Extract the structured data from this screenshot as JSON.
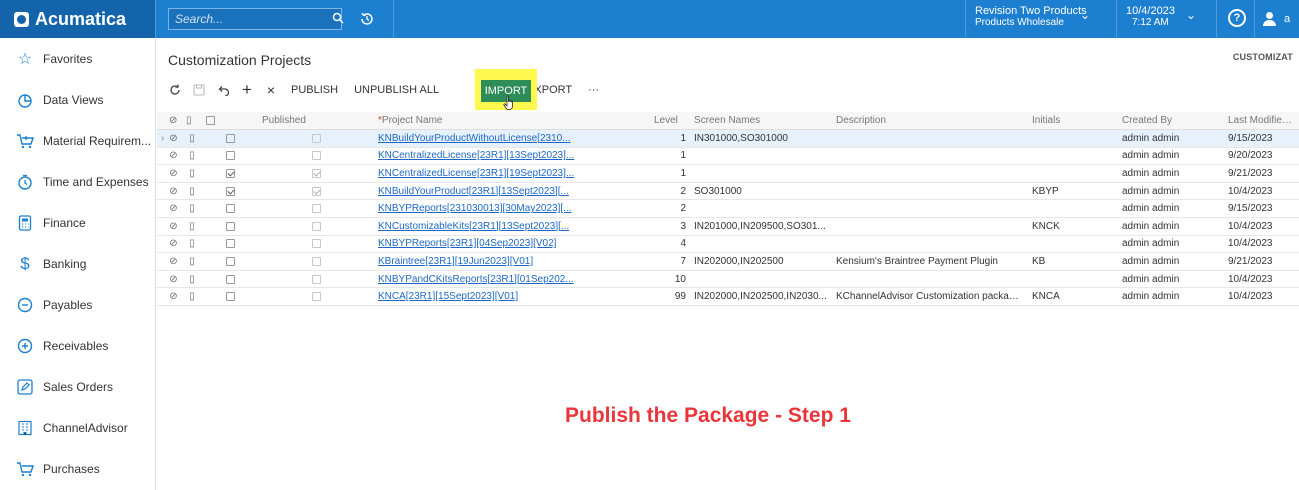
{
  "app": {
    "logo": "Acumatica",
    "search_placeholder": "Search...",
    "tenant_line1": "Revision Two Products",
    "tenant_line2": "Products Wholesale",
    "date": "10/4/2023",
    "time": "7:12 AM",
    "user_initials": "a"
  },
  "sidebar": {
    "items": [
      {
        "label": "Favorites",
        "icon": "star-icon"
      },
      {
        "label": "Data Views",
        "icon": "pie-chart-icon"
      },
      {
        "label": "Material Requirem...",
        "icon": "cart-icon"
      },
      {
        "label": "Time and Expenses",
        "icon": "clock-icon"
      },
      {
        "label": "Finance",
        "icon": "calculator-icon"
      },
      {
        "label": "Banking",
        "icon": "dollar-icon"
      },
      {
        "label": "Payables",
        "icon": "minus-circle-icon"
      },
      {
        "label": "Receivables",
        "icon": "plus-circle-icon"
      },
      {
        "label": "Sales Orders",
        "icon": "pencil-icon"
      },
      {
        "label": "ChannelAdvisor",
        "icon": "building-icon"
      },
      {
        "label": "Purchases",
        "icon": "cart-icon"
      }
    ]
  },
  "page": {
    "title": "Customization Projects",
    "tag": "CUSTOMIZAT"
  },
  "toolbar": {
    "publish": "PUBLISH",
    "unpublish_all": "UNPUBLISH ALL",
    "import": "IMPORT",
    "export": "EXPORT",
    "more": "···"
  },
  "grid": {
    "headers": {
      "published": "Published",
      "required_mark": "*",
      "project_name": "Project Name",
      "level": "Level",
      "screen_names": "Screen Names",
      "description": "Description",
      "initials": "Initials",
      "created_by": "Created By",
      "last_modified": "Last Modified On"
    },
    "rows": [
      {
        "checked": false,
        "published": false,
        "name": "KNBuildYourProductWithoutLicense[2310...",
        "level": "1",
        "screens": "IN301000,SO301000",
        "description": "",
        "initials": "",
        "created_by": "admin admin",
        "modified": "9/15/2023",
        "selected": true
      },
      {
        "checked": false,
        "published": false,
        "name": "KNCentralizedLicense[23R1][13Sept2023]...",
        "level": "1",
        "screens": "",
        "description": "",
        "initials": "",
        "created_by": "admin admin",
        "modified": "9/20/2023",
        "selected": false
      },
      {
        "checked": true,
        "published": true,
        "name": "KNCentralizedLicense[23R1][19Sept2023]...",
        "level": "1",
        "screens": "",
        "description": "",
        "initials": "",
        "created_by": "admin admin",
        "modified": "9/21/2023",
        "selected": false
      },
      {
        "checked": true,
        "published": true,
        "name": "KNBuildYourProduct[23R1][13Sept2023][...",
        "level": "2",
        "screens": "SO301000",
        "description": "",
        "initials": "KBYP",
        "created_by": "admin admin",
        "modified": "10/4/2023",
        "selected": false
      },
      {
        "checked": false,
        "published": false,
        "name": "KNBYPReports[231030013][30May2023][...",
        "level": "2",
        "screens": "",
        "description": "",
        "initials": "",
        "created_by": "admin admin",
        "modified": "9/15/2023",
        "selected": false
      },
      {
        "checked": false,
        "published": false,
        "name": "KNCustomizableKits[23R1][13Sept2023][...",
        "level": "3",
        "screens": "IN201000,IN209500,SO301...",
        "description": "",
        "initials": "KNCK",
        "created_by": "admin admin",
        "modified": "10/4/2023",
        "selected": false
      },
      {
        "checked": false,
        "published": false,
        "name": "KNBYPReports[23R1][04Sep2023][V02]",
        "level": "4",
        "screens": "",
        "description": "",
        "initials": "",
        "created_by": "admin admin",
        "modified": "10/4/2023",
        "selected": false
      },
      {
        "checked": false,
        "published": false,
        "name": "KBraintree[23R1][19Jun2023][V01]",
        "level": "7",
        "screens": "IN202000,IN202500",
        "description": "Kensium's Braintree Payment Plugin",
        "initials": "KB",
        "created_by": "admin admin",
        "modified": "9/21/2023",
        "selected": false
      },
      {
        "checked": false,
        "published": false,
        "name": "KNBYPandCKitsReports[23R1][01Sep202...",
        "level": "10",
        "screens": "",
        "description": "",
        "initials": "",
        "created_by": "admin admin",
        "modified": "10/4/2023",
        "selected": false
      },
      {
        "checked": false,
        "published": false,
        "name": "KNCA[23R1][15Sept2023][V01]",
        "level": "99",
        "screens": "IN202000,IN202500,IN2030...",
        "description": "KChannelAdvisor Customization package ...",
        "initials": "KNCA",
        "created_by": "admin admin",
        "modified": "10/4/2023",
        "selected": false
      }
    ]
  },
  "annotation": "Publish the Package - Step 1",
  "colors": {
    "topbar": "#1d7fd0",
    "logo_bg": "#1464ab",
    "import_button": "#2d8c58",
    "highlight": "#fff84d",
    "annotation": "#e8363b"
  }
}
